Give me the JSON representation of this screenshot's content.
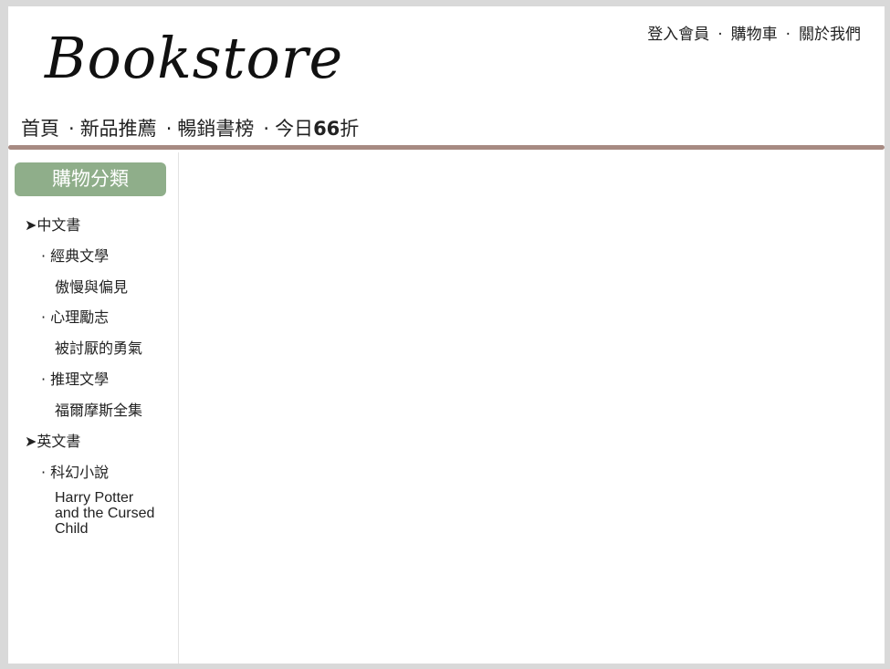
{
  "header": {
    "logo": "Bookstore",
    "top_links": [
      "登入會員",
      "購物車",
      "關於我們"
    ],
    "top_separator": "·"
  },
  "nav": {
    "separator": "·",
    "items": [
      "首頁",
      "新品推薦",
      "暢銷書榜"
    ],
    "deal_prefix": "今日",
    "deal_number": "66",
    "deal_suffix": "折"
  },
  "sidebar": {
    "title": "購物分類",
    "chinese_category": "➤中文書",
    "chinese_groups": [
      {
        "label": "· 經典文學",
        "book": "傲慢與偏見"
      },
      {
        "label": "· 心理勵志",
        "book": "被討厭的勇氣"
      },
      {
        "label": "· 推理文學",
        "book": "福爾摩斯全集"
      }
    ],
    "english_category": "➤英文書",
    "english_groups": [
      {
        "label": "· 科幻小說",
        "book": "Harry Potter and the Cursed Child"
      }
    ]
  }
}
